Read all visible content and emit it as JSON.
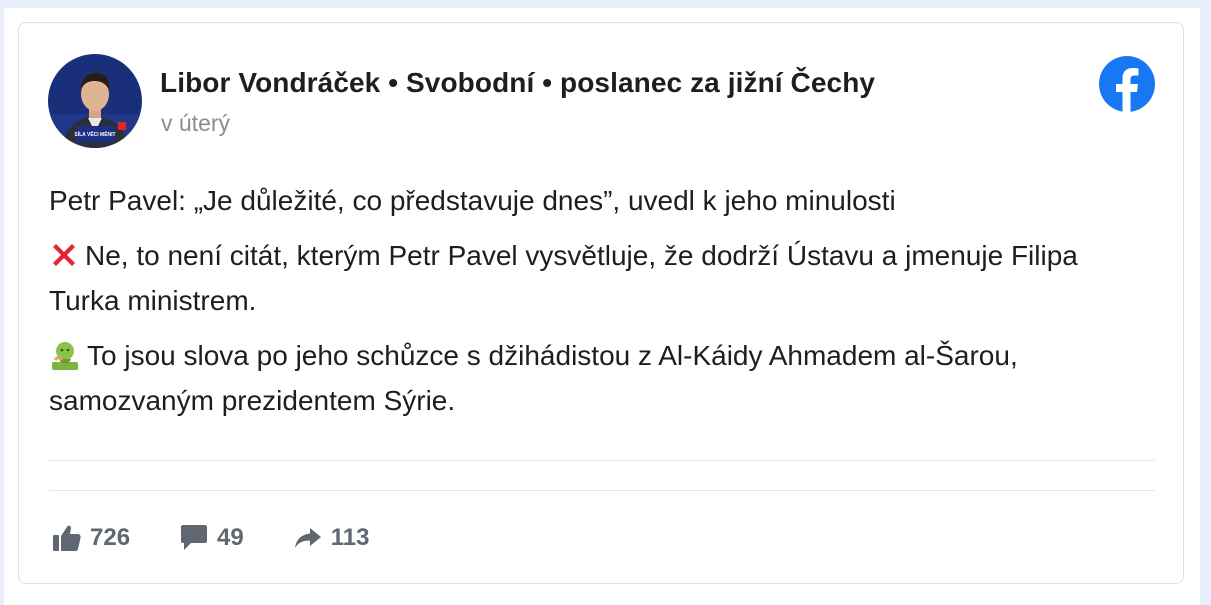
{
  "post": {
    "author": "Libor Vondráček • Svobodní • poslanec za jižní Čechy",
    "timestamp": "v úterý",
    "avatar_badge_text": "SÍLA VĚCI MĚNIT",
    "paragraphs": [
      {
        "emoji": "",
        "text": "Petr Pavel: „Je důležité, co představuje dnes”, uvedl k jeho minulosti"
      },
      {
        "emoji": "cross-mark-icon",
        "text": "Ne, to není citát, kterým Petr Pavel vysvětluje, že dodrží Ústavu a jmenuje Filipa Turka ministrem."
      },
      {
        "emoji": "nauseated-face-icon",
        "text": "To jsou slova po jeho schůzce s džihádistou z Al-Káidy Ahmadem al-Šarou, samozvaným prezidentem Sýrie."
      }
    ]
  },
  "stats": {
    "likes": "726",
    "comments": "49",
    "shares": "113"
  },
  "colors": {
    "facebook_blue": "#1877f2",
    "stat_gray": "#606770",
    "cross_red": "#e0262d",
    "nauseated_green": "#7cb342"
  }
}
